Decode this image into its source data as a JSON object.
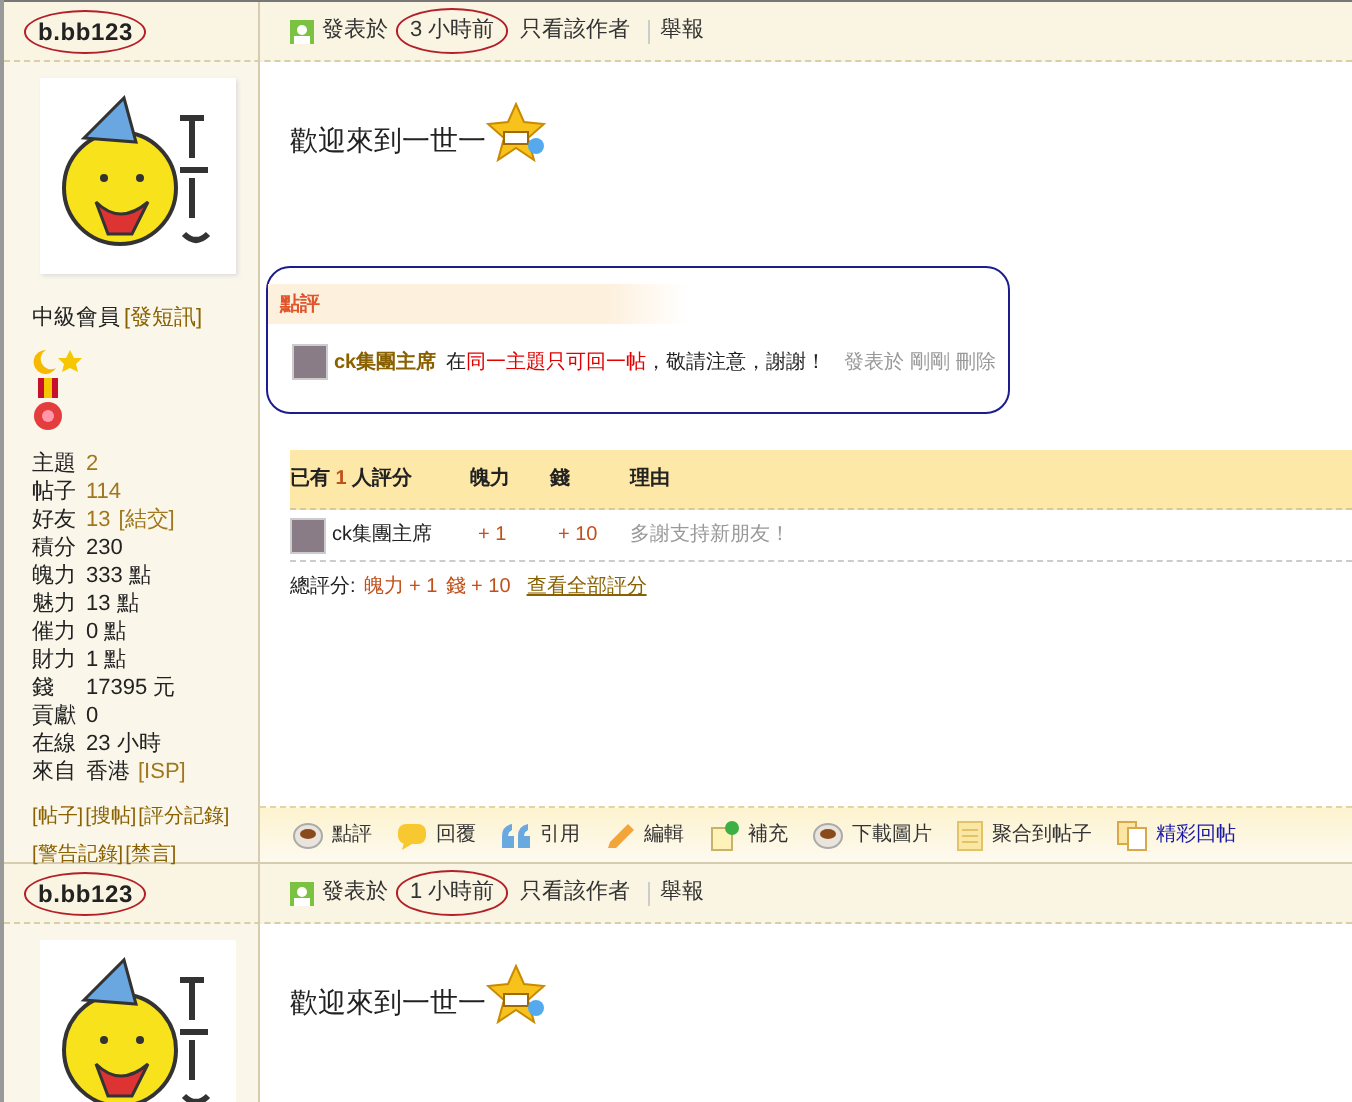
{
  "posts": [
    {
      "author": "b.bb123",
      "time_prefix": "發表於",
      "time": "3 小時前",
      "header_links": [
        "只看該作者",
        "舉報"
      ],
      "rank": "中級會員",
      "rank_link": "[發短訊]",
      "stats": [
        {
          "label": "主題",
          "value": "2",
          "linked": true
        },
        {
          "label": "帖子",
          "value": "114",
          "linked": true
        },
        {
          "label": "好友",
          "value": "13",
          "linked": true,
          "extra": "[結交]"
        },
        {
          "label": "積分",
          "value": "230",
          "linked": false
        },
        {
          "label": "魄力",
          "value": "333 點",
          "linked": false
        },
        {
          "label": "魅力",
          "value": "13 點",
          "linked": false
        },
        {
          "label": "催力",
          "value": "0 點",
          "linked": false
        },
        {
          "label": "財力",
          "value": "1 點",
          "linked": false
        },
        {
          "label": "錢",
          "value": "17395 元",
          "linked": false
        },
        {
          "label": "貢獻",
          "value": "0",
          "linked": false
        },
        {
          "label": "在線",
          "value": "23 小時",
          "linked": false
        },
        {
          "label": "來自",
          "value": "香港",
          "linked": false,
          "extra": "[ISP]"
        }
      ],
      "profile_links": [
        [
          "[帖子]",
          "[搜帖]",
          "[評分記錄]"
        ],
        [
          "[警告記錄]",
          "[禁言]"
        ]
      ],
      "body": "歡迎來到一世一",
      "comment": {
        "title": "點評",
        "user": "ck集團主席",
        "parts": [
          {
            "text": "在",
            "emphasis": false
          },
          {
            "text": "同一主題只可回一帖",
            "emphasis": true
          },
          {
            "text": "，敬請注意，謝謝！",
            "emphasis": false
          }
        ],
        "time": "發表於 剛剛",
        "delete": "刪除"
      },
      "ratings": {
        "prefix": "已有",
        "count": "1",
        "suffix": "人評分",
        "columns": [
          "魄力",
          "錢",
          "理由"
        ],
        "rows": [
          {
            "user": "ck集團主席",
            "values": [
              "+ 1",
              "+ 10"
            ],
            "reason": "多謝支持新朋友！"
          }
        ],
        "total_label": "總評分:",
        "totals": [
          "魄力 + 1",
          "錢 + 10"
        ],
        "view_all": "查看全部評分"
      },
      "actions": [
        {
          "label": "點評",
          "kind": "cup",
          "highlight": false
        },
        {
          "label": "回覆",
          "kind": "bubble",
          "highlight": false
        },
        {
          "label": "引用",
          "kind": "quote",
          "highlight": false
        },
        {
          "label": "編輯",
          "kind": "pencil",
          "highlight": false
        },
        {
          "label": "補充",
          "kind": "note",
          "highlight": false
        },
        {
          "label": "下載圖片",
          "kind": "cup",
          "highlight": false
        },
        {
          "label": "聚合到帖子",
          "kind": "doc",
          "highlight": false
        },
        {
          "label": "精彩回帖",
          "kind": "docs",
          "highlight": true
        }
      ]
    },
    {
      "author": "b.bb123",
      "time_prefix": "發表於",
      "time": "1 小時前",
      "header_links": [
        "只看該作者",
        "舉報"
      ],
      "body": "歡迎來到一世一"
    }
  ]
}
